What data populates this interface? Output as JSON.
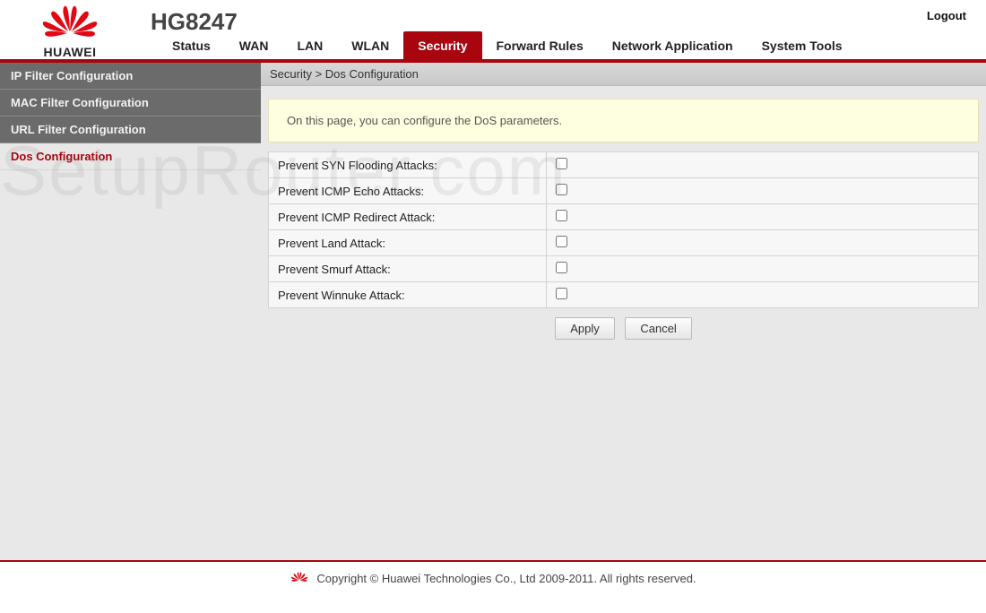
{
  "brand": "HUAWEI",
  "model": "HG8247",
  "logout": "Logout",
  "topnav": [
    {
      "label": "Status",
      "active": false
    },
    {
      "label": "WAN",
      "active": false
    },
    {
      "label": "LAN",
      "active": false
    },
    {
      "label": "WLAN",
      "active": false
    },
    {
      "label": "Security",
      "active": true
    },
    {
      "label": "Forward Rules",
      "active": false
    },
    {
      "label": "Network Application",
      "active": false
    },
    {
      "label": "System Tools",
      "active": false
    }
  ],
  "sidebar": [
    {
      "label": "IP Filter Configuration",
      "style": "dark"
    },
    {
      "label": "MAC Filter Configuration",
      "style": "dark"
    },
    {
      "label": "URL Filter Configuration",
      "style": "dark"
    },
    {
      "label": "Dos Configuration",
      "style": "active"
    }
  ],
  "breadcrumb": "Security > Dos Configuration",
  "info_text": "On this page, you can configure the DoS parameters.",
  "settings": [
    {
      "label": "Prevent SYN Flooding Attacks:",
      "checked": false
    },
    {
      "label": "Prevent ICMP Echo Attacks:",
      "checked": false
    },
    {
      "label": "Prevent ICMP Redirect Attack:",
      "checked": false
    },
    {
      "label": "Prevent Land Attack:",
      "checked": false
    },
    {
      "label": "Prevent Smurf Attack:",
      "checked": false
    },
    {
      "label": "Prevent Winnuke Attack:",
      "checked": false
    }
  ],
  "buttons": {
    "apply": "Apply",
    "cancel": "Cancel"
  },
  "footer": "Copyright © Huawei Technologies Co., Ltd 2009-2011. All rights reserved.",
  "watermark": "SetupRouter.com",
  "colors": {
    "accent": "#a8050e"
  }
}
